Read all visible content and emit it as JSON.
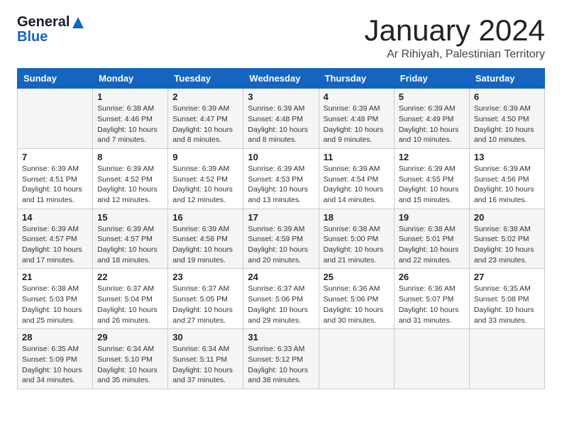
{
  "header": {
    "logo_line1": "General",
    "logo_line2": "Blue",
    "month_year": "January 2024",
    "location": "Ar Rihiyah, Palestinian Territory"
  },
  "weekdays": [
    "Sunday",
    "Monday",
    "Tuesday",
    "Wednesday",
    "Thursday",
    "Friday",
    "Saturday"
  ],
  "weeks": [
    [
      {
        "day": "",
        "sunrise": "",
        "sunset": "",
        "daylight": ""
      },
      {
        "day": "1",
        "sunrise": "Sunrise: 6:38 AM",
        "sunset": "Sunset: 4:46 PM",
        "daylight": "Daylight: 10 hours and 7 minutes."
      },
      {
        "day": "2",
        "sunrise": "Sunrise: 6:39 AM",
        "sunset": "Sunset: 4:47 PM",
        "daylight": "Daylight: 10 hours and 8 minutes."
      },
      {
        "day": "3",
        "sunrise": "Sunrise: 6:39 AM",
        "sunset": "Sunset: 4:48 PM",
        "daylight": "Daylight: 10 hours and 8 minutes."
      },
      {
        "day": "4",
        "sunrise": "Sunrise: 6:39 AM",
        "sunset": "Sunset: 4:48 PM",
        "daylight": "Daylight: 10 hours and 9 minutes."
      },
      {
        "day": "5",
        "sunrise": "Sunrise: 6:39 AM",
        "sunset": "Sunset: 4:49 PM",
        "daylight": "Daylight: 10 hours and 10 minutes."
      },
      {
        "day": "6",
        "sunrise": "Sunrise: 6:39 AM",
        "sunset": "Sunset: 4:50 PM",
        "daylight": "Daylight: 10 hours and 10 minutes."
      }
    ],
    [
      {
        "day": "7",
        "sunrise": "Sunrise: 6:39 AM",
        "sunset": "Sunset: 4:51 PM",
        "daylight": "Daylight: 10 hours and 11 minutes."
      },
      {
        "day": "8",
        "sunrise": "Sunrise: 6:39 AM",
        "sunset": "Sunset: 4:52 PM",
        "daylight": "Daylight: 10 hours and 12 minutes."
      },
      {
        "day": "9",
        "sunrise": "Sunrise: 6:39 AM",
        "sunset": "Sunset: 4:52 PM",
        "daylight": "Daylight: 10 hours and 12 minutes."
      },
      {
        "day": "10",
        "sunrise": "Sunrise: 6:39 AM",
        "sunset": "Sunset: 4:53 PM",
        "daylight": "Daylight: 10 hours and 13 minutes."
      },
      {
        "day": "11",
        "sunrise": "Sunrise: 6:39 AM",
        "sunset": "Sunset: 4:54 PM",
        "daylight": "Daylight: 10 hours and 14 minutes."
      },
      {
        "day": "12",
        "sunrise": "Sunrise: 6:39 AM",
        "sunset": "Sunset: 4:55 PM",
        "daylight": "Daylight: 10 hours and 15 minutes."
      },
      {
        "day": "13",
        "sunrise": "Sunrise: 6:39 AM",
        "sunset": "Sunset: 4:56 PM",
        "daylight": "Daylight: 10 hours and 16 minutes."
      }
    ],
    [
      {
        "day": "14",
        "sunrise": "Sunrise: 6:39 AM",
        "sunset": "Sunset: 4:57 PM",
        "daylight": "Daylight: 10 hours and 17 minutes."
      },
      {
        "day": "15",
        "sunrise": "Sunrise: 6:39 AM",
        "sunset": "Sunset: 4:57 PM",
        "daylight": "Daylight: 10 hours and 18 minutes."
      },
      {
        "day": "16",
        "sunrise": "Sunrise: 6:39 AM",
        "sunset": "Sunset: 4:58 PM",
        "daylight": "Daylight: 10 hours and 19 minutes."
      },
      {
        "day": "17",
        "sunrise": "Sunrise: 6:39 AM",
        "sunset": "Sunset: 4:59 PM",
        "daylight": "Daylight: 10 hours and 20 minutes."
      },
      {
        "day": "18",
        "sunrise": "Sunrise: 6:38 AM",
        "sunset": "Sunset: 5:00 PM",
        "daylight": "Daylight: 10 hours and 21 minutes."
      },
      {
        "day": "19",
        "sunrise": "Sunrise: 6:38 AM",
        "sunset": "Sunset: 5:01 PM",
        "daylight": "Daylight: 10 hours and 22 minutes."
      },
      {
        "day": "20",
        "sunrise": "Sunrise: 6:38 AM",
        "sunset": "Sunset: 5:02 PM",
        "daylight": "Daylight: 10 hours and 23 minutes."
      }
    ],
    [
      {
        "day": "21",
        "sunrise": "Sunrise: 6:38 AM",
        "sunset": "Sunset: 5:03 PM",
        "daylight": "Daylight: 10 hours and 25 minutes."
      },
      {
        "day": "22",
        "sunrise": "Sunrise: 6:37 AM",
        "sunset": "Sunset: 5:04 PM",
        "daylight": "Daylight: 10 hours and 26 minutes."
      },
      {
        "day": "23",
        "sunrise": "Sunrise: 6:37 AM",
        "sunset": "Sunset: 5:05 PM",
        "daylight": "Daylight: 10 hours and 27 minutes."
      },
      {
        "day": "24",
        "sunrise": "Sunrise: 6:37 AM",
        "sunset": "Sunset: 5:06 PM",
        "daylight": "Daylight: 10 hours and 29 minutes."
      },
      {
        "day": "25",
        "sunrise": "Sunrise: 6:36 AM",
        "sunset": "Sunset: 5:06 PM",
        "daylight": "Daylight: 10 hours and 30 minutes."
      },
      {
        "day": "26",
        "sunrise": "Sunrise: 6:36 AM",
        "sunset": "Sunset: 5:07 PM",
        "daylight": "Daylight: 10 hours and 31 minutes."
      },
      {
        "day": "27",
        "sunrise": "Sunrise: 6:35 AM",
        "sunset": "Sunset: 5:08 PM",
        "daylight": "Daylight: 10 hours and 33 minutes."
      }
    ],
    [
      {
        "day": "28",
        "sunrise": "Sunrise: 6:35 AM",
        "sunset": "Sunset: 5:09 PM",
        "daylight": "Daylight: 10 hours and 34 minutes."
      },
      {
        "day": "29",
        "sunrise": "Sunrise: 6:34 AM",
        "sunset": "Sunset: 5:10 PM",
        "daylight": "Daylight: 10 hours and 35 minutes."
      },
      {
        "day": "30",
        "sunrise": "Sunrise: 6:34 AM",
        "sunset": "Sunset: 5:11 PM",
        "daylight": "Daylight: 10 hours and 37 minutes."
      },
      {
        "day": "31",
        "sunrise": "Sunrise: 6:33 AM",
        "sunset": "Sunset: 5:12 PM",
        "daylight": "Daylight: 10 hours and 38 minutes."
      },
      {
        "day": "",
        "sunrise": "",
        "sunset": "",
        "daylight": ""
      },
      {
        "day": "",
        "sunrise": "",
        "sunset": "",
        "daylight": ""
      },
      {
        "day": "",
        "sunrise": "",
        "sunset": "",
        "daylight": ""
      }
    ]
  ]
}
